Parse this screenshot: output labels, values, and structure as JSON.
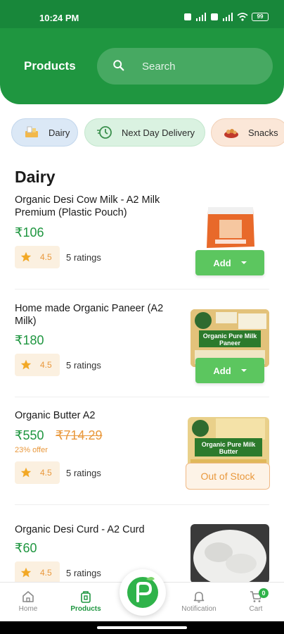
{
  "status_bar": {
    "time": "10:24 PM",
    "battery": "99"
  },
  "header": {
    "title": "Products",
    "search_placeholder": "Search"
  },
  "categories": [
    {
      "label": "Dairy"
    },
    {
      "label": "Next Day Delivery"
    },
    {
      "label": "Snacks"
    }
  ],
  "section_title": "Dairy",
  "products": [
    {
      "name": " Organic Desi Cow Milk - A2 Milk Premium (Plastic Pouch)",
      "price": "₹106",
      "rating": "4.5",
      "rating_count": "5 ratings",
      "action": "Add"
    },
    {
      "name": "Home made Organic Paneer (A2 Milk)",
      "price": "₹180",
      "rating": "4.5",
      "rating_count": "5 ratings",
      "action": "Add",
      "image_text": "Organic Pure Milk Paneer"
    },
    {
      "name": "Organic Butter A2",
      "price": "₹550",
      "old_price": "₹714.29",
      "offer": "23% offer",
      "rating": "4.5",
      "rating_count": "5 ratings",
      "action": "Out of Stock",
      "image_text": "Organic Pure Milk Butter"
    },
    {
      "name": "Organic Desi Curd - A2 Curd",
      "price": "₹60",
      "rating": "4.5",
      "rating_count": "5 ratings"
    }
  ],
  "bottom_nav": {
    "home": "Home",
    "products": "Products",
    "notification": "Notification",
    "cart": "Cart",
    "cart_count": "0"
  },
  "colors": {
    "brand_green": "#1f9640",
    "button_green": "#5cc65f",
    "accent_orange": "#e9983c"
  }
}
